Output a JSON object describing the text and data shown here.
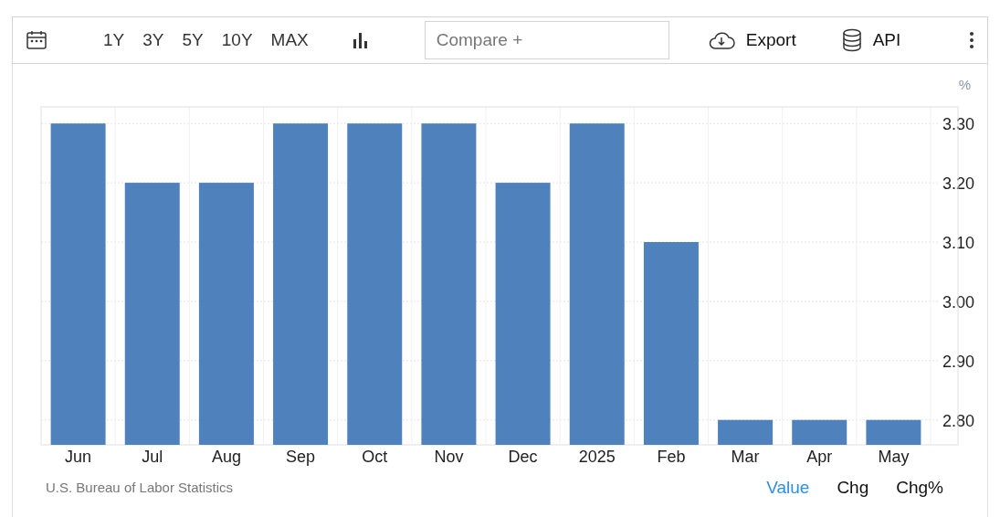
{
  "toolbar": {
    "ranges": [
      "1Y",
      "3Y",
      "5Y",
      "10Y",
      "MAX"
    ],
    "compare": {
      "placeholder": "Compare +"
    },
    "export": "Export",
    "api": "API"
  },
  "chart": {
    "unit": "%",
    "chart_data": {
      "type": "bar",
      "categories": [
        "Jun",
        "Jul",
        "Aug",
        "Sep",
        "Oct",
        "Nov",
        "Dec",
        "2025",
        "Feb",
        "Mar",
        "Apr",
        "May"
      ],
      "grid": true,
      "series": [
        {
          "color": "#4f81bd",
          "values": [
            3.3,
            3.2,
            3.2,
            3.3,
            3.3,
            3.3,
            3.2,
            3.3,
            3.1,
            2.8,
            2.8,
            2.8
          ]
        }
      ],
      "ylim": [
        2.758,
        3.328
      ],
      "yticks": [
        {
          "value": 2.8,
          "label": "2.80"
        },
        {
          "value": 2.9,
          "label": "2.90"
        },
        {
          "value": 3.0,
          "label": "3.00"
        },
        {
          "value": 3.1,
          "label": "3.10"
        },
        {
          "value": 3.2,
          "label": "3.20"
        },
        {
          "value": 3.3,
          "label": "3.30"
        }
      ]
    }
  },
  "footer": {
    "source": "U.S. Bureau of Labor Statistics",
    "modes": [
      {
        "label": "Value",
        "selected": true
      },
      {
        "label": "Chg",
        "selected": false
      },
      {
        "label": "Chg%",
        "selected": false
      }
    ]
  }
}
